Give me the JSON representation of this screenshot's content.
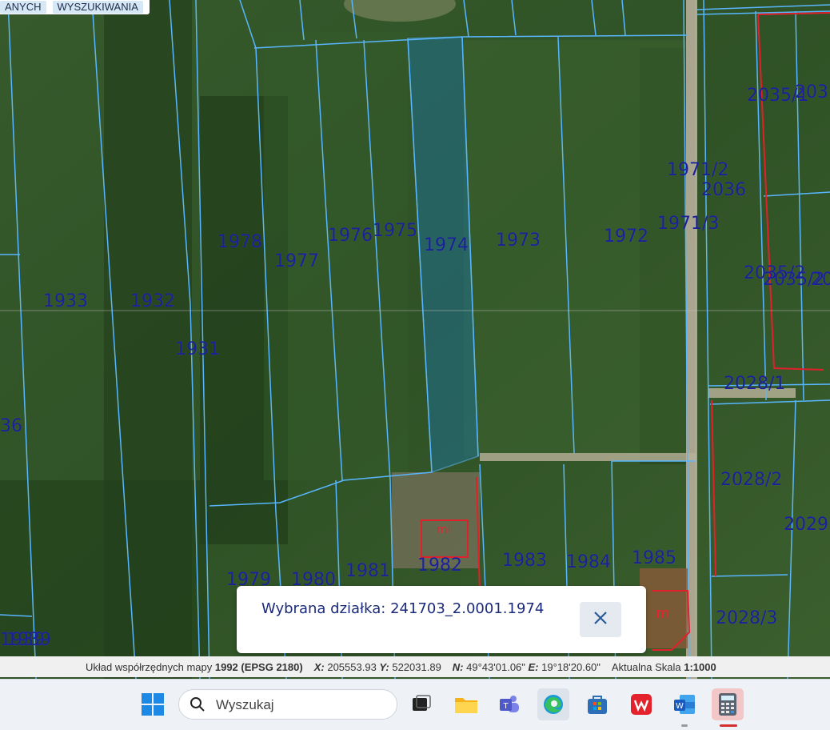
{
  "toolbar": {
    "buttons": [
      "ANYCH",
      "WYSZUKIWANIA"
    ]
  },
  "map": {
    "parcels": [
      {
        "label": "1933"
      },
      {
        "label": "1932"
      },
      {
        "label": "1931"
      },
      {
        "label": "1978"
      },
      {
        "label": "1977"
      },
      {
        "label": "1976"
      },
      {
        "label": "1975"
      },
      {
        "label": "1974"
      },
      {
        "label": "1973"
      },
      {
        "label": "1972"
      },
      {
        "label": "1971/2"
      },
      {
        "label": "2036"
      },
      {
        "label": "1971/3"
      },
      {
        "label": "2035/1"
      },
      {
        "label": "203"
      },
      {
        "label": "2035/2"
      },
      {
        "label": "2035/2"
      },
      {
        "label": "20"
      },
      {
        "label": "2028/1"
      },
      {
        "label": "2028/2"
      },
      {
        "label": "2029"
      },
      {
        "label": "2028/3"
      },
      {
        "label": "36"
      },
      {
        "label": "1979"
      },
      {
        "label": "1980"
      },
      {
        "label": "1981"
      },
      {
        "label": "1982"
      },
      {
        "label": "1983"
      },
      {
        "label": "1984"
      },
      {
        "label": "1985"
      },
      {
        "label": "1939"
      },
      {
        "label": "1939"
      }
    ],
    "building_labels": [
      "mi",
      "m"
    ],
    "selected_color": "#1f6f8f",
    "border_color": "#58b6ff",
    "building_color": "#e0202a"
  },
  "popup": {
    "label": "Wybrana działka: 241703_2.0001.1974",
    "close_icon": "close-icon"
  },
  "statusbar": {
    "crs_prefix": "Układ współrzędnych mapy",
    "crs_value": "1992 (EPSG 2180)",
    "x_label": "X:",
    "x_value": "205553.93",
    "y_label": "Y:",
    "y_value": "522031.89",
    "n_label": "N:",
    "n_value": "49°43'01.06\"",
    "e_label": "E:",
    "e_value": "19°18'20.60\"",
    "scale_label": "Aktualna Skala",
    "scale_value": "1:1000"
  },
  "taskbar": {
    "search_placeholder": "Wyszukaj",
    "apps": [
      "windows-start-icon",
      "task-view-icon",
      "file-explorer-icon",
      "teams-icon",
      "edge-icon",
      "microsoft-store-icon",
      "wps-office-icon",
      "word-icon",
      "calculator-icon"
    ]
  }
}
